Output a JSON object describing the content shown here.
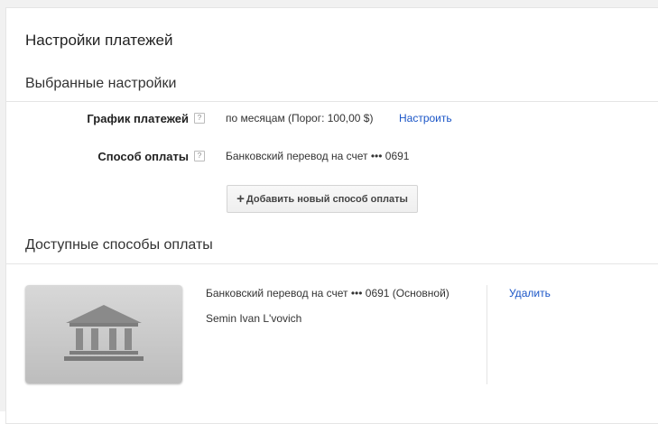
{
  "page": {
    "title": "Настройки платежей"
  },
  "selected_settings": {
    "heading": "Выбранные настройки",
    "schedule_label": "График платежей",
    "schedule_value": "по месяцам (Порог: 100,00 $)",
    "schedule_link": "Настроить",
    "method_label": "Способ оплаты",
    "method_value": "Банковский перевод на счет ••• 0691",
    "help_glyph": "?"
  },
  "add_button": {
    "plus": "+",
    "label": "Добавить новый способ оплаты"
  },
  "available_methods": {
    "heading": "Доступные способы оплаты",
    "items": [
      {
        "description": "Банковский перевод на счет ••• 0691 (Основной)",
        "holder": "Semin Ivan L'vovich",
        "remove_link": "Удалить",
        "icon": "bank-icon"
      }
    ]
  },
  "colors": {
    "link": "#1a55c7",
    "divider": "#e5e5e5"
  }
}
